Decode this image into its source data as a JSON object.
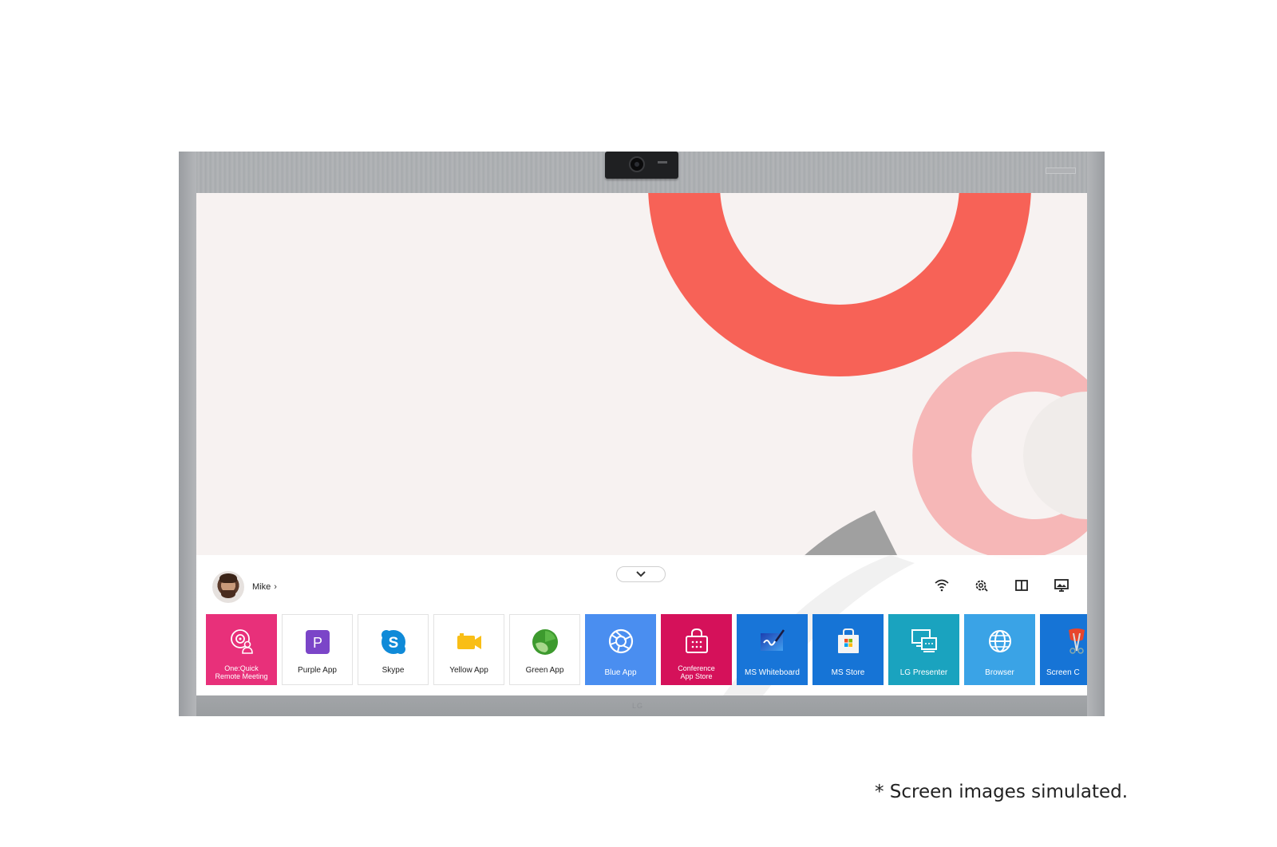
{
  "user": {
    "name": "Mike",
    "chevron": "›"
  },
  "dock": {
    "collapse_label": "collapse-dock",
    "system_icons": [
      {
        "name": "wifi-icon"
      },
      {
        "name": "settings-icon"
      },
      {
        "name": "split-screen-icon"
      },
      {
        "name": "screen-share-icon"
      }
    ],
    "apps": [
      {
        "label": "One:Quick Remote Meeting",
        "line1": "One:Quick",
        "line2": "Remote Meeting",
        "color": "#e8307a",
        "icon": "remote-meeting-icon"
      },
      {
        "label": "Purple App",
        "color": "#ffffff",
        "icon": "purple-app-icon",
        "glyph": "P"
      },
      {
        "label": "Skype",
        "color": "#ffffff",
        "icon": "skype-icon",
        "glyph": "S"
      },
      {
        "label": "Yellow App",
        "color": "#ffffff",
        "icon": "video-camera-icon"
      },
      {
        "label": "Green App",
        "color": "#ffffff",
        "icon": "green-app-icon"
      },
      {
        "label": "Blue App",
        "color": "#4a8ef0",
        "icon": "aperture-icon"
      },
      {
        "label": "Conference App Store",
        "line1": "Conference",
        "line2": "App Store",
        "color": "#d5115a",
        "icon": "shopping-bag-icon"
      },
      {
        "label": "MS Whiteboard",
        "color": "#1875d8",
        "icon": "whiteboard-icon"
      },
      {
        "label": "MS Store",
        "color": "#1674d6",
        "icon": "ms-store-icon"
      },
      {
        "label": "LG Presenter",
        "color": "#1aa3bf",
        "icon": "presenter-icon"
      },
      {
        "label": "Browser",
        "color": "#3aa3e6",
        "icon": "globe-icon"
      },
      {
        "label": "Screen C",
        "color": "#1674d6",
        "icon": "screen-capture-icon"
      }
    ]
  },
  "colors": {
    "accent_red": "#f76257",
    "accent_pink": "#f6b7b7",
    "deco_gray": "#9e9e9e"
  },
  "hardware": {
    "brand": "LG"
  },
  "footnote": "* Screen images simulated."
}
